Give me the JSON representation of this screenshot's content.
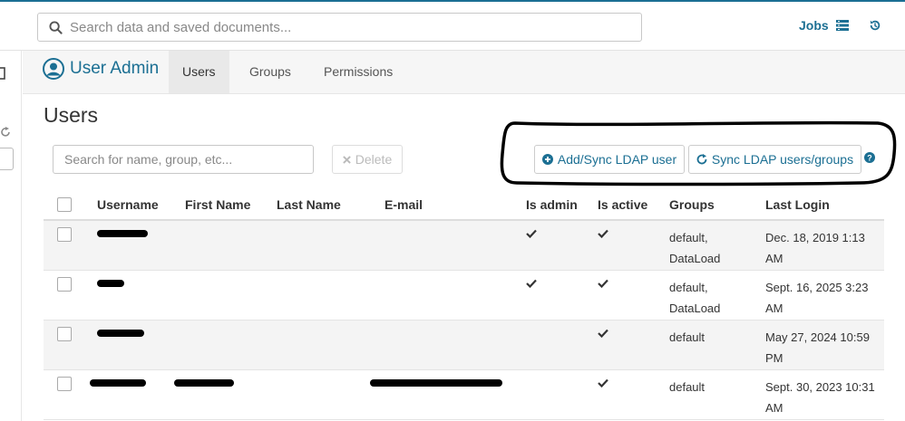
{
  "topbar": {
    "search_placeholder": "Search data and saved documents...",
    "jobs_label": "Jobs"
  },
  "subheader": {
    "app_title": "User Admin",
    "tabs": [
      {
        "label": "Users",
        "active": true
      },
      {
        "label": "Groups",
        "active": false
      },
      {
        "label": "Permissions",
        "active": false
      }
    ]
  },
  "page": {
    "title": "Users",
    "search_placeholder": "Search for name, group, etc...",
    "delete_label": "Delete",
    "add_sync_label": "Add/Sync LDAP user",
    "sync_label": "Sync LDAP users/groups"
  },
  "table": {
    "columns": [
      "Username",
      "First Name",
      "Last Name",
      "E-mail",
      "Is admin",
      "Is active",
      "Groups",
      "Last Login"
    ],
    "rows": [
      {
        "username_redacted": true,
        "first_name": "",
        "last_name": "",
        "email": "",
        "is_admin": true,
        "is_active": true,
        "groups_line1": "default,",
        "groups_line2": "DataLoad",
        "login_line1": "Dec. 18, 2019 1:13",
        "login_line2": "AM"
      },
      {
        "username_redacted": true,
        "first_name": "",
        "last_name": "",
        "email": "",
        "is_admin": true,
        "is_active": true,
        "groups_line1": "default,",
        "groups_line2": "DataLoad",
        "login_line1": "Sept. 16, 2025 3:23",
        "login_line2": "AM"
      },
      {
        "username_redacted": true,
        "first_name": "",
        "last_name": "",
        "email": "",
        "is_admin": false,
        "is_active": true,
        "groups_line1": "default",
        "groups_line2": "",
        "login_line1": "May 27, 2024 10:59",
        "login_line2": "PM"
      },
      {
        "username_redacted": true,
        "first_name": "",
        "last_name": "",
        "email": "",
        "is_admin": false,
        "is_active": true,
        "groups_line1": "default",
        "groups_line2": "",
        "login_line1": "Sept. 30, 2023 10:31",
        "login_line2": "AM"
      }
    ]
  },
  "icons": {
    "search": "search-icon",
    "jobs": "list-icon",
    "history": "history-icon",
    "user": "user-circle-icon",
    "delete": "times-icon",
    "add": "plus-circle-icon",
    "sync": "refresh-icon",
    "help": "question-circle-icon"
  },
  "colors": {
    "accent": "#1b6f93",
    "row_alt": "#f4f4f4"
  }
}
